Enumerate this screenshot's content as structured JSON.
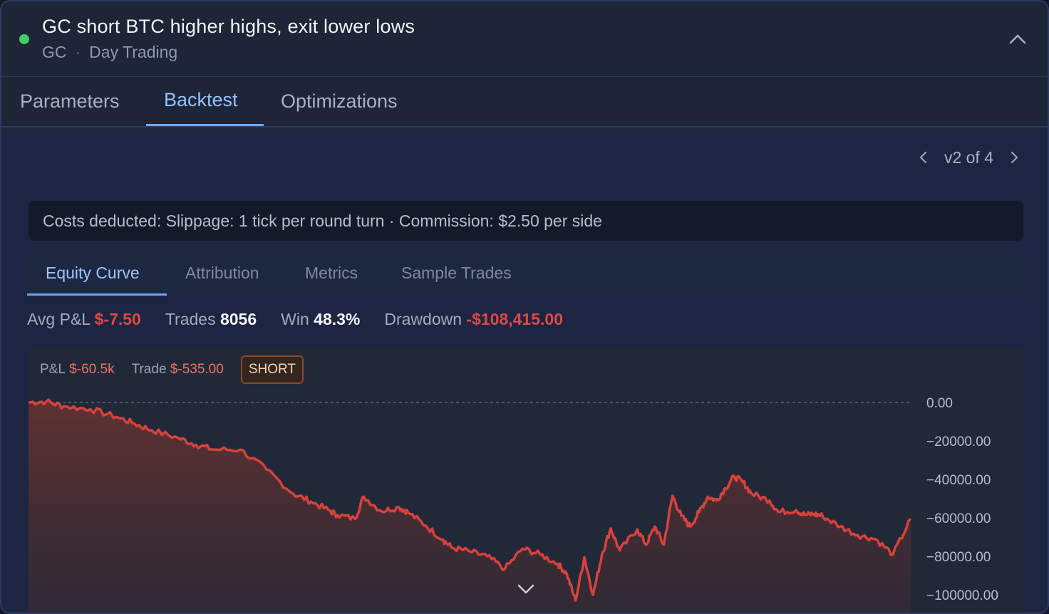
{
  "header": {
    "title": "GC short BTC higher highs, exit lower lows",
    "symbol": "GC",
    "category": "Day Trading",
    "status_color": "#3fcf63"
  },
  "tabs": [
    {
      "label": "Parameters",
      "active": false
    },
    {
      "label": "Backtest",
      "active": true
    },
    {
      "label": "Optimizations",
      "active": false
    }
  ],
  "version": {
    "label": "v2 of 4",
    "prev_icon": "chevron-left-icon",
    "next_icon": "chevron-right-icon"
  },
  "costs_note": "Costs deducted: Slippage: 1 tick per round turn · Commission: $2.50 per side",
  "subtabs": [
    {
      "label": "Equity Curve",
      "active": true
    },
    {
      "label": "Attribution",
      "active": false
    },
    {
      "label": "Metrics",
      "active": false
    },
    {
      "label": "Sample Trades",
      "active": false
    }
  ],
  "stats": {
    "avg_pnl_label": "Avg P&L",
    "avg_pnl_value": "$-7.50",
    "trades_label": "Trades",
    "trades_value": "8056",
    "win_label": "Win",
    "win_value": "48.3%",
    "drawdown_label": "Drawdown",
    "drawdown_value": "-$108,415.00"
  },
  "legend": {
    "pnl_label": "P&L",
    "pnl_value": "$-60.5k",
    "trade_label": "Trade",
    "trade_value": "$-535.00",
    "side_badge": "SHORT"
  },
  "colors": {
    "accent": "#6ea6f0",
    "negative": "#e04844",
    "line": "#d9413b",
    "short_badge_border": "#8b4a26"
  },
  "chart_data": {
    "type": "area",
    "title": "",
    "xlabel": "",
    "ylabel": "",
    "ylim": [
      -108000,
      0
    ],
    "y_ticks": [
      "0.00",
      "−20000.00",
      "−40000.00",
      "−60000.00",
      "−80000.00",
      "−100000.00"
    ],
    "y_tick_values": [
      0,
      -20000,
      -40000,
      -60000,
      -80000,
      -100000
    ],
    "grid": "dashed line at 0",
    "x": [
      0,
      2,
      4,
      7,
      10,
      12,
      14,
      17,
      19,
      21,
      24,
      27,
      30,
      32,
      34,
      35,
      37,
      38,
      40,
      42,
      43,
      45,
      47,
      48,
      50,
      52,
      54,
      56,
      58,
      60,
      61,
      62,
      63,
      64,
      65,
      66,
      67,
      69,
      70,
      71,
      72,
      73,
      74,
      75,
      76,
      77,
      78,
      79,
      80,
      81,
      82,
      84,
      85,
      87,
      88,
      89,
      90,
      92,
      94,
      96,
      98,
      100
    ],
    "series": [
      {
        "values": [
          0,
          500,
          -2000,
          -3500,
          -7500,
          -11000,
          -14500,
          -18500,
          -22000,
          -24500,
          -24500,
          -35000,
          -47500,
          -51500,
          -56000,
          -58500,
          -60500,
          -49000,
          -56500,
          -54500,
          -57000,
          -64000,
          -71500,
          -75500,
          -77500,
          -80000,
          -86500,
          -76000,
          -79000,
          -84000,
          -89000,
          -103000,
          -80500,
          -100000,
          -79000,
          -65500,
          -77000,
          -66000,
          -74000,
          -64500,
          -74000,
          -48500,
          -59000,
          -64500,
          -57000,
          -49000,
          -51000,
          -44500,
          -38500,
          -41500,
          -47500,
          -51000,
          -57000,
          -56000,
          -58500,
          -58000,
          -59000,
          -64500,
          -69000,
          -71000,
          -79000,
          -60500
        ]
      }
    ]
  }
}
